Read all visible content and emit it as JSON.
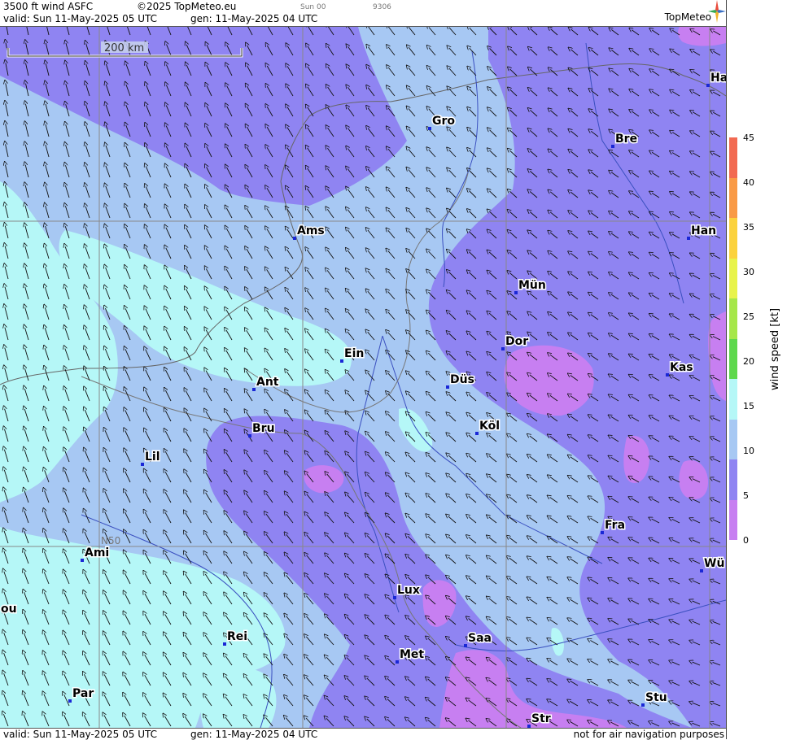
{
  "header": {
    "title": "3500 ft wind ASFC",
    "copyright": "©2025 TopMeteo.eu",
    "valid": "valid:  Sun  11-May-2025  05 UTC",
    "gen": "gen: 11-May-2025 04 UTC",
    "small1": "Sun 00",
    "small2": "9306",
    "brand": "TopMeteo"
  },
  "footer": {
    "valid": "valid:  Sun  11-May-2025  05 UTC",
    "gen": "gen: 11-May-2025 04 UTC",
    "disclaimer": "not for air navigation purposes"
  },
  "scale": {
    "label": "200 km"
  },
  "grid_label": "N50",
  "legend": {
    "title": "wind  speed  [kt]",
    "ticks": [
      "45",
      "40",
      "35",
      "30",
      "25",
      "20",
      "15",
      "10",
      "5",
      "0"
    ],
    "colors": [
      "#f26a52",
      "#f99a46",
      "#fbd23d",
      "#e8f34b",
      "#a6e74a",
      "#5dd84d",
      "#b5f7f7",
      "#a7c8f3",
      "#8f84f2",
      "#c77ff1"
    ]
  },
  "cities": [
    {
      "name": "Gro"
    },
    {
      "name": "Bre"
    },
    {
      "name": "Ha"
    },
    {
      "name": "Ams"
    },
    {
      "name": "Han"
    },
    {
      "name": "Mün"
    },
    {
      "name": "Dor"
    },
    {
      "name": "Ein"
    },
    {
      "name": "Kas"
    },
    {
      "name": "Ant"
    },
    {
      "name": "Düs"
    },
    {
      "name": "Bru"
    },
    {
      "name": "Köl"
    },
    {
      "name": "Lil"
    },
    {
      "name": "Fra"
    },
    {
      "name": "Ami"
    },
    {
      "name": "Wü"
    },
    {
      "name": "Lux"
    },
    {
      "name": "ou"
    },
    {
      "name": "Rei"
    },
    {
      "name": "Saa"
    },
    {
      "name": "Met"
    },
    {
      "name": "Par"
    },
    {
      "name": "Stu"
    },
    {
      "name": "Str"
    }
  ]
}
